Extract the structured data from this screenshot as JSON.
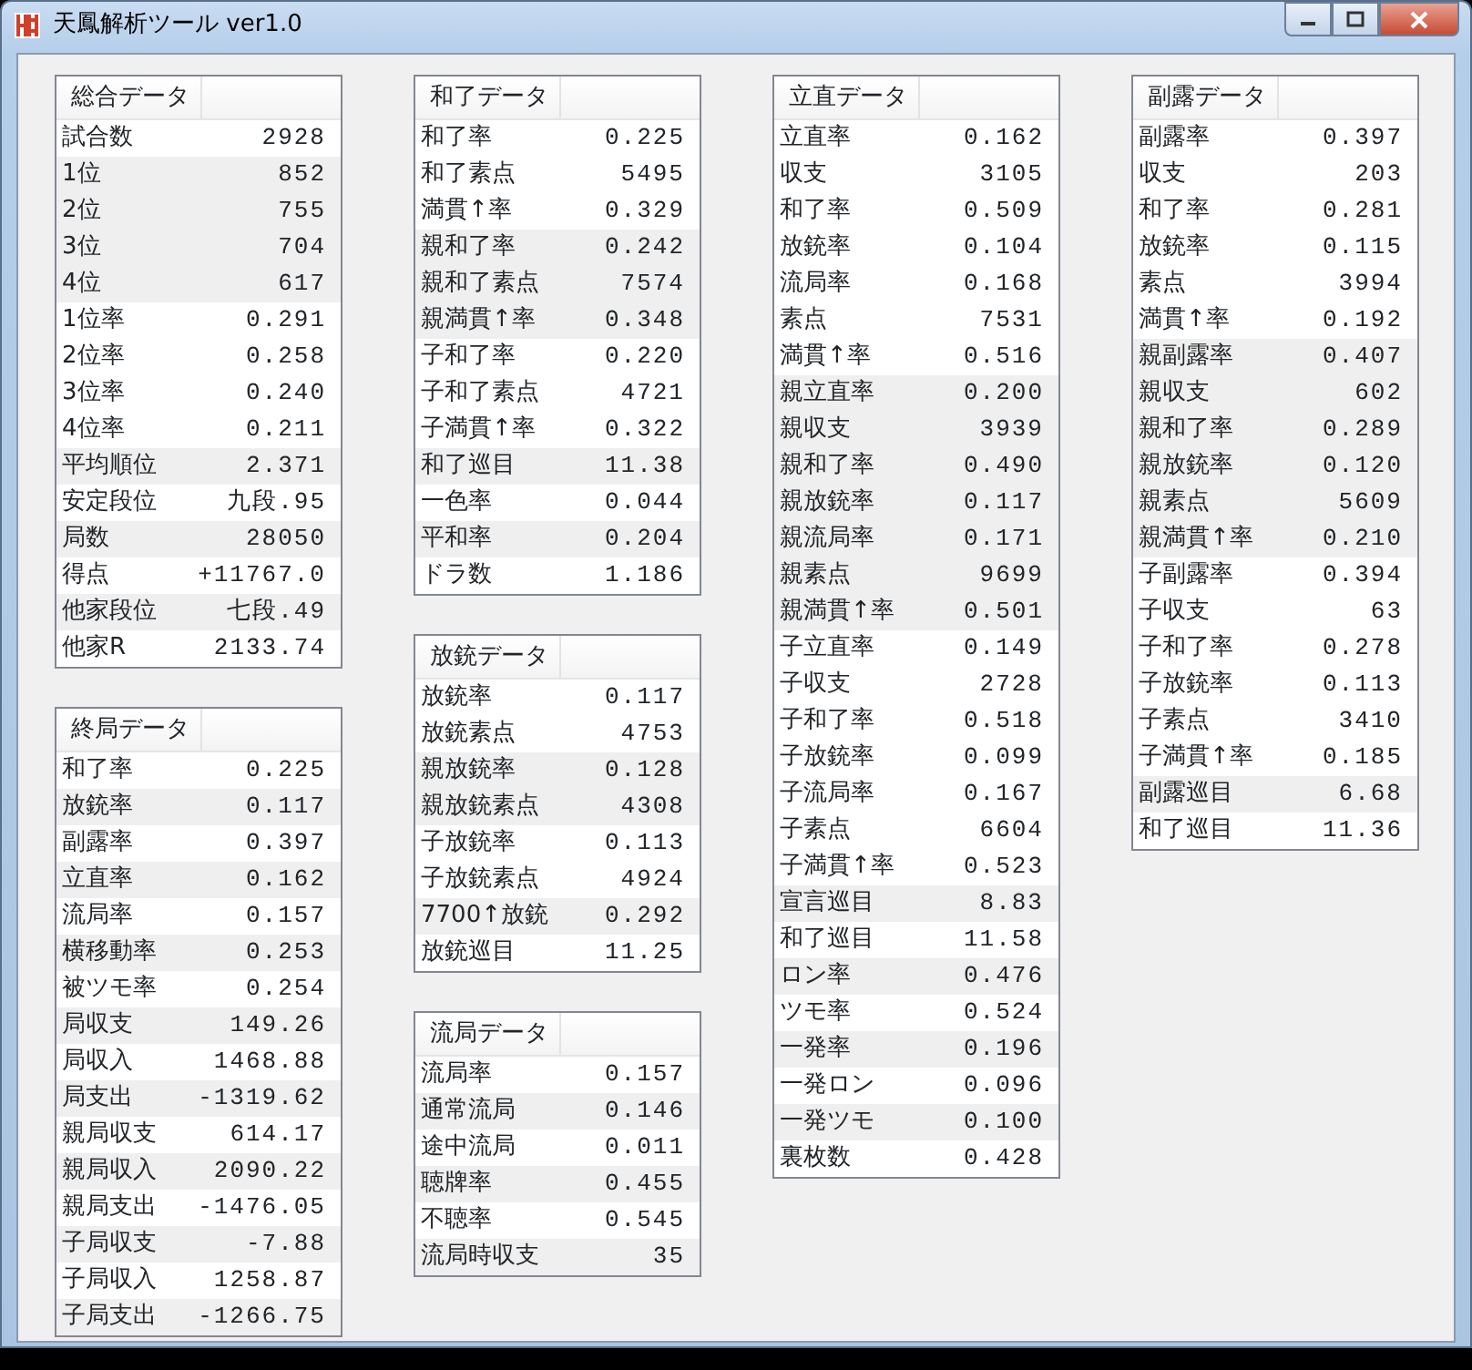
{
  "window": {
    "title": "天鳳解析ツール ver1.0"
  },
  "columns": [
    {
      "panels": [
        {
          "title": "総合データ",
          "rows": [
            {
              "label": "試合数",
              "value": "2928",
              "shaded": false
            },
            {
              "label": "1位",
              "value": "852",
              "shaded": true
            },
            {
              "label": "2位",
              "value": "755",
              "shaded": true
            },
            {
              "label": "3位",
              "value": "704",
              "shaded": true
            },
            {
              "label": "4位",
              "value": "617",
              "shaded": true
            },
            {
              "label": "1位率",
              "value": "0.291",
              "shaded": false
            },
            {
              "label": "2位率",
              "value": "0.258",
              "shaded": false
            },
            {
              "label": "3位率",
              "value": "0.240",
              "shaded": false
            },
            {
              "label": "4位率",
              "value": "0.211",
              "shaded": false
            },
            {
              "label": "平均順位",
              "value": "2.371",
              "shaded": true
            },
            {
              "label": "安定段位",
              "value": "九段.95",
              "shaded": false
            },
            {
              "label": "局数",
              "value": "28050",
              "shaded": true
            },
            {
              "label": "得点",
              "value": "+11767.0",
              "shaded": false
            },
            {
              "label": "他家段位",
              "value": "七段.49",
              "shaded": true
            },
            {
              "label": "他家R",
              "value": "2133.74",
              "shaded": false
            }
          ]
        },
        {
          "title": "終局データ",
          "rows": [
            {
              "label": "和了率",
              "value": "0.225",
              "shaded": false
            },
            {
              "label": "放銃率",
              "value": "0.117",
              "shaded": true
            },
            {
              "label": "副露率",
              "value": "0.397",
              "shaded": false
            },
            {
              "label": "立直率",
              "value": "0.162",
              "shaded": true
            },
            {
              "label": "流局率",
              "value": "0.157",
              "shaded": false
            },
            {
              "label": "横移動率",
              "value": "0.253",
              "shaded": true
            },
            {
              "label": "被ツモ率",
              "value": "0.254",
              "shaded": false
            },
            {
              "label": "局収支",
              "value": "149.26",
              "shaded": true
            },
            {
              "label": "局収入",
              "value": "1468.88",
              "shaded": false
            },
            {
              "label": "局支出",
              "value": "-1319.62",
              "shaded": true
            },
            {
              "label": "親局収支",
              "value": "614.17",
              "shaded": false
            },
            {
              "label": "親局収入",
              "value": "2090.22",
              "shaded": true
            },
            {
              "label": "親局支出",
              "value": "-1476.05",
              "shaded": false
            },
            {
              "label": "子局収支",
              "value": "-7.88",
              "shaded": true
            },
            {
              "label": "子局収入",
              "value": "1258.87",
              "shaded": false
            },
            {
              "label": "子局支出",
              "value": "-1266.75",
              "shaded": true
            }
          ]
        }
      ]
    },
    {
      "panels": [
        {
          "title": "和了データ",
          "rows": [
            {
              "label": "和了率",
              "value": "0.225",
              "shaded": false
            },
            {
              "label": "和了素点",
              "value": "5495",
              "shaded": false
            },
            {
              "label": "満貫↑率",
              "value": "0.329",
              "shaded": false
            },
            {
              "label": "親和了率",
              "value": "0.242",
              "shaded": true
            },
            {
              "label": "親和了素点",
              "value": "7574",
              "shaded": true
            },
            {
              "label": "親満貫↑率",
              "value": "0.348",
              "shaded": true
            },
            {
              "label": "子和了率",
              "value": "0.220",
              "shaded": false
            },
            {
              "label": "子和了素点",
              "value": "4721",
              "shaded": false
            },
            {
              "label": "子満貫↑率",
              "value": "0.322",
              "shaded": false
            },
            {
              "label": "和了巡目",
              "value": "11.38",
              "shaded": true
            },
            {
              "label": "一色率",
              "value": "0.044",
              "shaded": false
            },
            {
              "label": "平和率",
              "value": "0.204",
              "shaded": true
            },
            {
              "label": "ドラ数",
              "value": "1.186",
              "shaded": false
            }
          ]
        },
        {
          "title": "放銃データ",
          "rows": [
            {
              "label": "放銃率",
              "value": "0.117",
              "shaded": false
            },
            {
              "label": "放銃素点",
              "value": "4753",
              "shaded": false
            },
            {
              "label": "親放銃率",
              "value": "0.128",
              "shaded": true
            },
            {
              "label": "親放銃素点",
              "value": "4308",
              "shaded": true
            },
            {
              "label": "子放銃率",
              "value": "0.113",
              "shaded": false
            },
            {
              "label": "子放銃素点",
              "value": "4924",
              "shaded": false
            },
            {
              "label": "7700↑放銃",
              "value": "0.292",
              "shaded": true
            },
            {
              "label": "放銃巡目",
              "value": "11.25",
              "shaded": false
            }
          ]
        },
        {
          "title": "流局データ",
          "rows": [
            {
              "label": "流局率",
              "value": "0.157",
              "shaded": false
            },
            {
              "label": "通常流局",
              "value": "0.146",
              "shaded": true
            },
            {
              "label": "途中流局",
              "value": "0.011",
              "shaded": false
            },
            {
              "label": "聴牌率",
              "value": "0.455",
              "shaded": true
            },
            {
              "label": "不聴率",
              "value": "0.545",
              "shaded": false
            },
            {
              "label": "流局時収支",
              "value": "35",
              "shaded": true
            }
          ]
        }
      ]
    },
    {
      "panels": [
        {
          "title": "立直データ",
          "rows": [
            {
              "label": "立直率",
              "value": "0.162",
              "shaded": false
            },
            {
              "label": "収支",
              "value": "3105",
              "shaded": false
            },
            {
              "label": "和了率",
              "value": "0.509",
              "shaded": false
            },
            {
              "label": "放銃率",
              "value": "0.104",
              "shaded": false
            },
            {
              "label": "流局率",
              "value": "0.168",
              "shaded": false
            },
            {
              "label": "素点",
              "value": "7531",
              "shaded": false
            },
            {
              "label": "満貫↑率",
              "value": "0.516",
              "shaded": false
            },
            {
              "label": "親立直率",
              "value": "0.200",
              "shaded": true
            },
            {
              "label": "親収支",
              "value": "3939",
              "shaded": true
            },
            {
              "label": "親和了率",
              "value": "0.490",
              "shaded": true
            },
            {
              "label": "親放銃率",
              "value": "0.117",
              "shaded": true
            },
            {
              "label": "親流局率",
              "value": "0.171",
              "shaded": true
            },
            {
              "label": "親素点",
              "value": "9699",
              "shaded": true
            },
            {
              "label": "親満貫↑率",
              "value": "0.501",
              "shaded": true
            },
            {
              "label": "子立直率",
              "value": "0.149",
              "shaded": false
            },
            {
              "label": "子収支",
              "value": "2728",
              "shaded": false
            },
            {
              "label": "子和了率",
              "value": "0.518",
              "shaded": false
            },
            {
              "label": "子放銃率",
              "value": "0.099",
              "shaded": false
            },
            {
              "label": "子流局率",
              "value": "0.167",
              "shaded": false
            },
            {
              "label": "子素点",
              "value": "6604",
              "shaded": false
            },
            {
              "label": "子満貫↑率",
              "value": "0.523",
              "shaded": false
            },
            {
              "label": "宣言巡目",
              "value": "8.83",
              "shaded": true
            },
            {
              "label": "和了巡目",
              "value": "11.58",
              "shaded": false
            },
            {
              "label": "ロン率",
              "value": "0.476",
              "shaded": true
            },
            {
              "label": "ツモ率",
              "value": "0.524",
              "shaded": false
            },
            {
              "label": "一発率",
              "value": "0.196",
              "shaded": true
            },
            {
              "label": "一発ロン",
              "value": "0.096",
              "shaded": false
            },
            {
              "label": "一発ツモ",
              "value": "0.100",
              "shaded": true
            },
            {
              "label": "裏枚数",
              "value": "0.428",
              "shaded": false
            }
          ]
        }
      ]
    },
    {
      "panels": [
        {
          "title": "副露データ",
          "rows": [
            {
              "label": "副露率",
              "value": "0.397",
              "shaded": false
            },
            {
              "label": "収支",
              "value": "203",
              "shaded": false
            },
            {
              "label": "和了率",
              "value": "0.281",
              "shaded": false
            },
            {
              "label": "放銃率",
              "value": "0.115",
              "shaded": false
            },
            {
              "label": "素点",
              "value": "3994",
              "shaded": false
            },
            {
              "label": "満貫↑率",
              "value": "0.192",
              "shaded": false
            },
            {
              "label": "親副露率",
              "value": "0.407",
              "shaded": true
            },
            {
              "label": "親収支",
              "value": "602",
              "shaded": true
            },
            {
              "label": "親和了率",
              "value": "0.289",
              "shaded": true
            },
            {
              "label": "親放銃率",
              "value": "0.120",
              "shaded": true
            },
            {
              "label": "親素点",
              "value": "5609",
              "shaded": true
            },
            {
              "label": "親満貫↑率",
              "value": "0.210",
              "shaded": true
            },
            {
              "label": "子副露率",
              "value": "0.394",
              "shaded": false
            },
            {
              "label": "子収支",
              "value": "63",
              "shaded": false
            },
            {
              "label": "子和了率",
              "value": "0.278",
              "shaded": false
            },
            {
              "label": "子放銃率",
              "value": "0.113",
              "shaded": false
            },
            {
              "label": "子素点",
              "value": "3410",
              "shaded": false
            },
            {
              "label": "子満貫↑率",
              "value": "0.185",
              "shaded": false
            },
            {
              "label": "副露巡目",
              "value": "6.68",
              "shaded": true
            },
            {
              "label": "和了巡目",
              "value": "11.36",
              "shaded": false
            }
          ]
        }
      ]
    }
  ]
}
